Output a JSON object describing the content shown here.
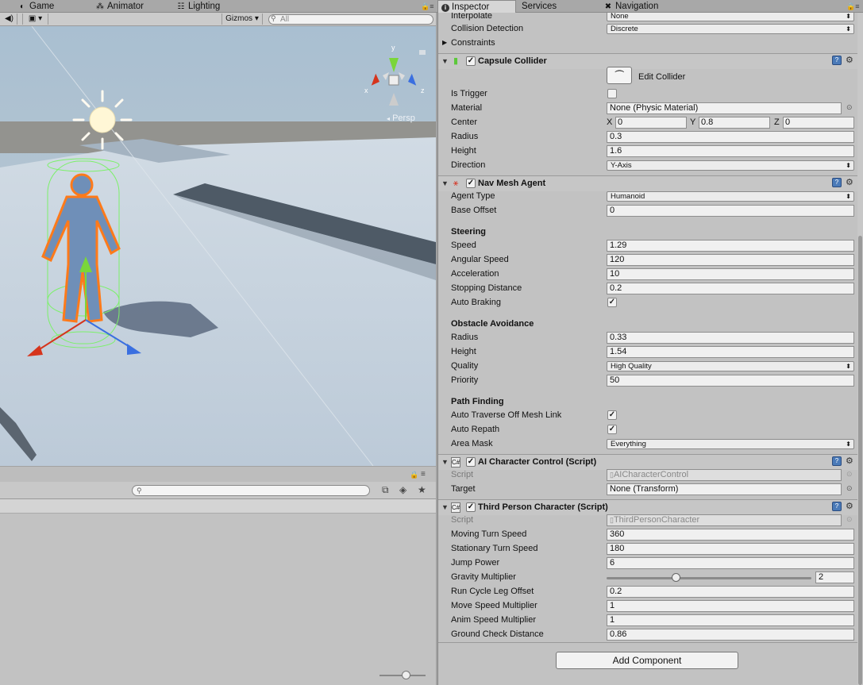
{
  "tabs": {
    "game": "Game",
    "animator": "Animator",
    "lighting": "Lighting",
    "inspector": "Inspector",
    "services": "Services",
    "navigation": "Navigation"
  },
  "scene_toolbar": {
    "gizmos": "Gizmos",
    "search_placeholder": "All"
  },
  "scene_view": {
    "projection": "Persp",
    "axis_labels": {
      "x": "x",
      "y": "y",
      "z": "z"
    }
  },
  "rigidbody": {
    "interpolate_label": "Interpolate",
    "interpolate_value": "None",
    "collision_label": "Collision Detection",
    "collision_value": "Discrete",
    "constraints_label": "Constraints"
  },
  "capsule": {
    "title": "Capsule Collider",
    "edit_collider": "Edit Collider",
    "is_trigger_label": "Is Trigger",
    "material_label": "Material",
    "material_value": "None (Physic Material)",
    "center_label": "Center",
    "center": {
      "x_label": "X",
      "x": "0",
      "y_label": "Y",
      "y": "0.8",
      "z_label": "Z",
      "z": "0"
    },
    "radius_label": "Radius",
    "radius": "0.3",
    "height_label": "Height",
    "height": "1.6",
    "direction_label": "Direction",
    "direction": "Y-Axis"
  },
  "nav_agent": {
    "title": "Nav Mesh Agent",
    "agent_type_label": "Agent Type",
    "agent_type": "Humanoid",
    "base_offset_label": "Base Offset",
    "base_offset": "0",
    "steering_header": "Steering",
    "speed_label": "Speed",
    "speed": "1.29",
    "angular_label": "Angular Speed",
    "angular": "120",
    "accel_label": "Acceleration",
    "accel": "10",
    "stopping_label": "Stopping Distance",
    "stopping": "0.2",
    "auto_braking_label": "Auto Braking",
    "obstacle_header": "Obstacle Avoidance",
    "oa_radius_label": "Radius",
    "oa_radius": "0.33",
    "oa_height_label": "Height",
    "oa_height": "1.54",
    "quality_label": "Quality",
    "quality": "High Quality",
    "priority_label": "Priority",
    "priority": "50",
    "path_header": "Path Finding",
    "auto_traverse_label": "Auto Traverse Off Mesh Link",
    "auto_repath_label": "Auto Repath",
    "area_mask_label": "Area Mask",
    "area_mask": "Everything"
  },
  "ai_control": {
    "title": "AI Character Control (Script)",
    "script_label": "Script",
    "script_value": "AICharacterControl",
    "target_label": "Target",
    "target_value": "None (Transform)"
  },
  "third_person": {
    "title": "Third Person Character (Script)",
    "script_label": "Script",
    "script_value": "ThirdPersonCharacter",
    "moving_turn_label": "Moving Turn Speed",
    "moving_turn": "360",
    "stationary_turn_label": "Stationary Turn Speed",
    "stationary_turn": "180",
    "jump_label": "Jump Power",
    "jump": "6",
    "gravity_label": "Gravity Multiplier",
    "gravity": "2",
    "gravity_slider_fraction": 0.33,
    "run_cycle_label": "Run Cycle Leg Offset",
    "run_cycle": "0.2",
    "move_speed_label": "Move Speed Multiplier",
    "move_speed": "1",
    "anim_speed_label": "Anim Speed Multiplier",
    "anim_speed": "1",
    "ground_check_label": "Ground Check Distance",
    "ground_check": "0.86"
  },
  "add_component": "Add Component",
  "icons": {
    "game_tab": "pacman-icon",
    "animator_tab": "nodes-icon",
    "lighting_tab": "lighting-icon",
    "inspector_tab": "info-icon",
    "navigation_tab": "navigation-icon",
    "help": "help-book-icon",
    "gear": "gear-icon",
    "lock": "lock-icon",
    "menu": "panel-menu-icon"
  },
  "colors": {
    "panel_bg": "#c2c2c2",
    "help_blue": "#4a7ab8",
    "sky": "#b3c6d6",
    "ground": "#c9d6e2",
    "character": "#6f8fb8",
    "selection_outline": "#ff7a1a",
    "collider_green": "#7cf06a",
    "axis_x": "#d6341c",
    "axis_y": "#7ad63a",
    "axis_z": "#3a6fe0"
  }
}
